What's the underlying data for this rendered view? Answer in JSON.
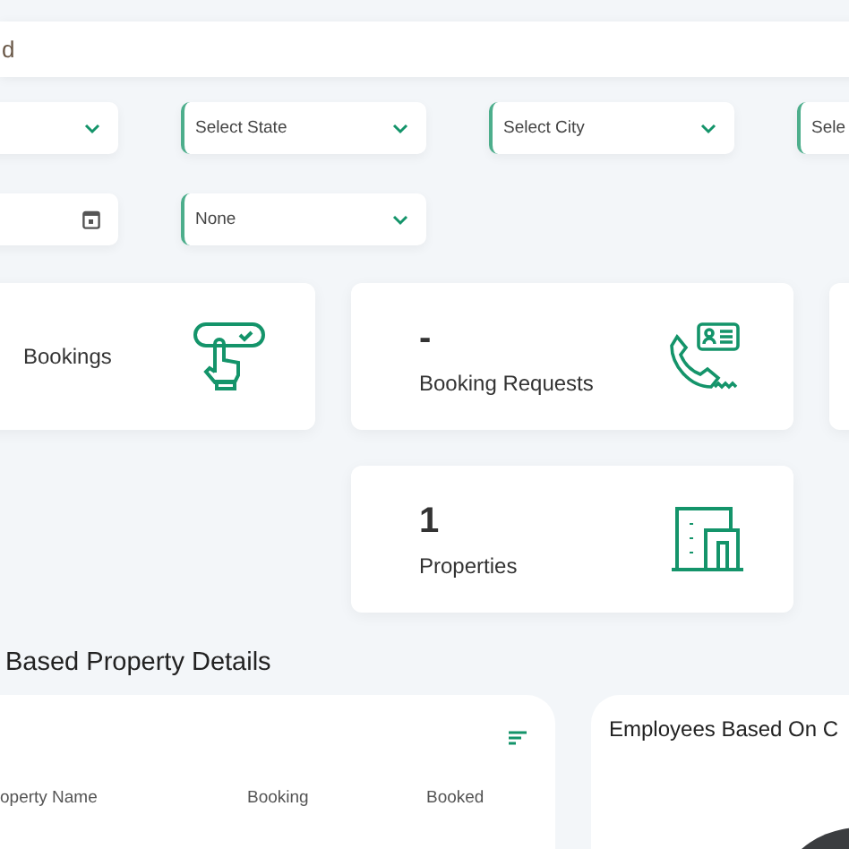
{
  "header": {
    "text": "d"
  },
  "filters": [
    {
      "kind": "select"
    },
    {
      "kind": "select",
      "placeholder": "Select State"
    },
    {
      "kind": "select",
      "placeholder": "Select City"
    },
    {
      "kind": "select",
      "placeholder": "Sele"
    },
    {
      "kind": "date"
    },
    {
      "kind": "select",
      "value": "None"
    }
  ],
  "cards": [
    {
      "kind": "bookings",
      "label": "Bookings"
    },
    {
      "kind": "requests",
      "value": "-",
      "label": "Booking Requests"
    },
    {
      "kind": "blank"
    },
    {
      "kind": "properties",
      "value": "1",
      "label": "Properties"
    }
  ],
  "section": {
    "title": "Based Property Details"
  },
  "table": {
    "columns": [
      "operty Name",
      "Booking",
      "Booked"
    ]
  },
  "employees": {
    "title": "Employees Based On C"
  }
}
